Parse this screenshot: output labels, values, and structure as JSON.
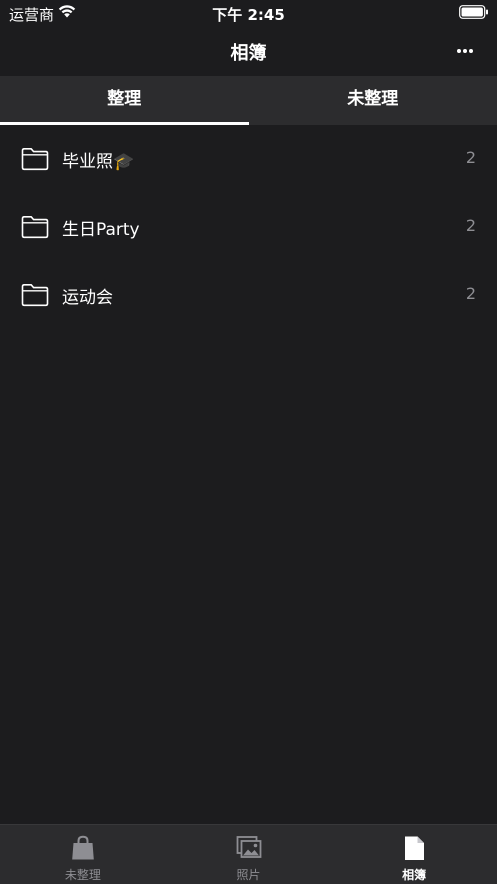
{
  "status_bar": {
    "carrier": "运营商",
    "time": "下午 2:45"
  },
  "nav": {
    "title": "相簿"
  },
  "segments": [
    {
      "label": "整理",
      "active": true
    },
    {
      "label": "未整理",
      "active": false
    }
  ],
  "albums": [
    {
      "name": "毕业照🎓",
      "count": "2"
    },
    {
      "name": "生日Party",
      "count": "2"
    },
    {
      "name": "运动会",
      "count": "2"
    }
  ],
  "tab_bar": [
    {
      "label": "未整理",
      "icon": "bag-icon",
      "active": false
    },
    {
      "label": "照片",
      "icon": "photos-icon",
      "active": false
    },
    {
      "label": "相簿",
      "icon": "document-icon",
      "active": true
    }
  ],
  "colors": {
    "background": "#1c1c1e",
    "surface": "#2c2c2e",
    "text": "#ffffff",
    "secondary_text": "#8e8e93"
  }
}
